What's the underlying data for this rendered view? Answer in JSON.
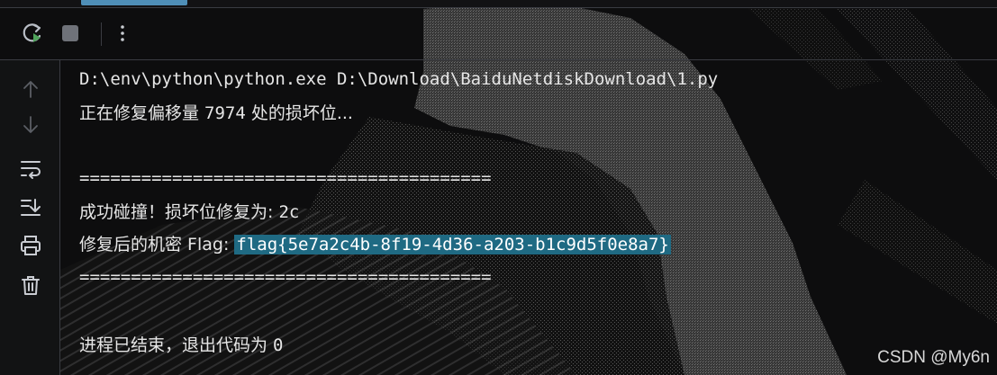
{
  "toolbar": {
    "rerun_icon": "rerun-icon",
    "stop_icon": "stop-icon",
    "more_icon": "more-vertical-icon"
  },
  "gutter": {
    "icons": [
      "arrow-up-icon",
      "arrow-down-icon",
      "soft-wrap-icon",
      "scroll-to-end-icon",
      "print-icon",
      "trash-icon"
    ]
  },
  "console": {
    "command": "D:\\env\\python\\python.exe D:\\Download\\BaiduNetdiskDownload\\1.py",
    "repair_prefix": "正在修复偏移量 ",
    "repair_offset": "7974",
    "repair_suffix": " 处的损坏位...",
    "separator": "========================================",
    "collision_label": "成功碰撞！损坏位修复为: ",
    "collision_value": "2c",
    "flag_label": "修复后的机密 Flag: ",
    "flag_value": "flag{5e7a2c4b-8f19-4d36-a203-b1c9d5f0e8a7}",
    "exit_label": "进程已结束，退出代码为 ",
    "exit_code": "0"
  },
  "watermark": "CSDN @My6n",
  "colors": {
    "background": "#0e0e0f",
    "text": "#e6e6e6",
    "selection": "#1f6a83",
    "tab_accent": "#4f8fb8",
    "rerun_green": "#4ea35a"
  }
}
